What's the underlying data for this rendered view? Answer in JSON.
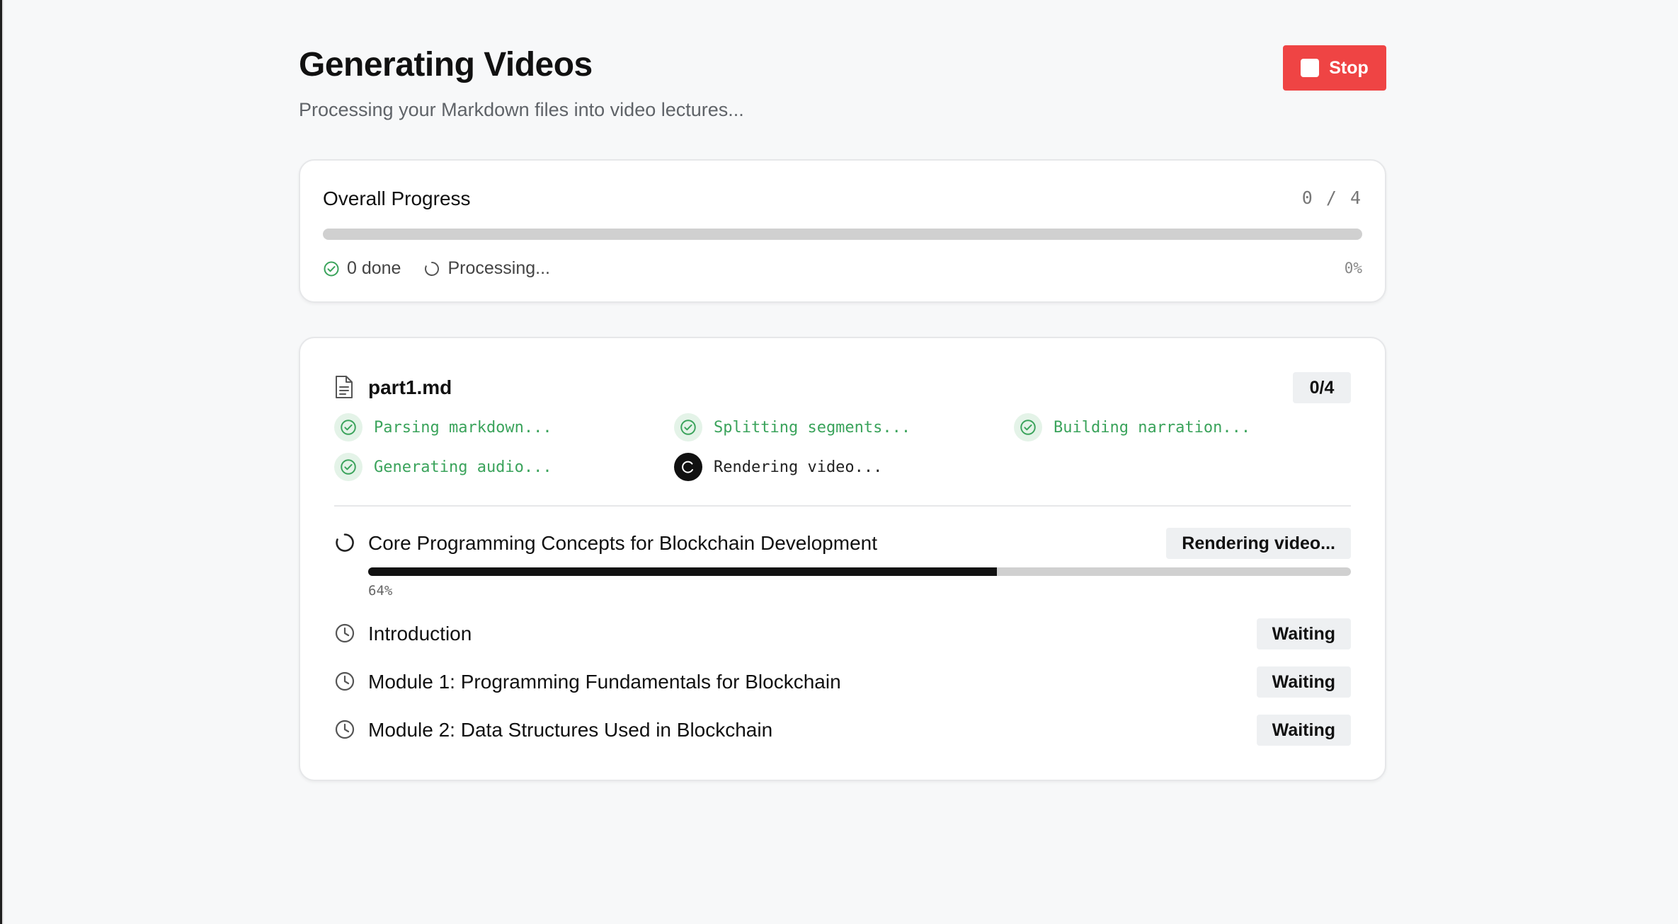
{
  "header": {
    "title": "Generating Videos",
    "subtitle": "Processing your Markdown files into video lectures...",
    "stop_label": "Stop"
  },
  "overall": {
    "label": "Overall Progress",
    "count": "0 / 4",
    "progress_fraction": 0,
    "done_text": "0 done",
    "processing_text": "Processing...",
    "percent_text": "0%"
  },
  "file": {
    "name": "part1.md",
    "badge": "0/4",
    "steps": [
      {
        "label": "Parsing markdown...",
        "status": "done",
        "icon": "check-circle-icon"
      },
      {
        "label": "Splitting segments...",
        "status": "done",
        "icon": "check-circle-icon"
      },
      {
        "label": "Building narration...",
        "status": "done",
        "icon": "check-circle-icon"
      },
      {
        "label": "Generating audio...",
        "status": "done",
        "icon": "check-circle-icon"
      },
      {
        "label": "Rendering video...",
        "status": "active",
        "icon": "spinner-icon"
      }
    ],
    "videos": [
      {
        "title": "Core Programming Concepts for Blockchain Development",
        "status": "Rendering video...",
        "progress_fraction": 0.64,
        "percent_text": "64%",
        "icon": "spinner-icon"
      },
      {
        "title": "Introduction",
        "status": "Waiting",
        "icon": "clock-icon"
      },
      {
        "title": "Module 1: Programming Fundamentals for Blockchain",
        "status": "Waiting",
        "icon": "clock-icon"
      },
      {
        "title": "Module 2: Data Structures Used in Blockchain",
        "status": "Waiting",
        "icon": "clock-icon"
      }
    ]
  },
  "colors": {
    "stop_button": "#ef4444",
    "success": "#3aa35b",
    "progress_fill": "#111111",
    "progress_track": "#d0d0d0"
  }
}
